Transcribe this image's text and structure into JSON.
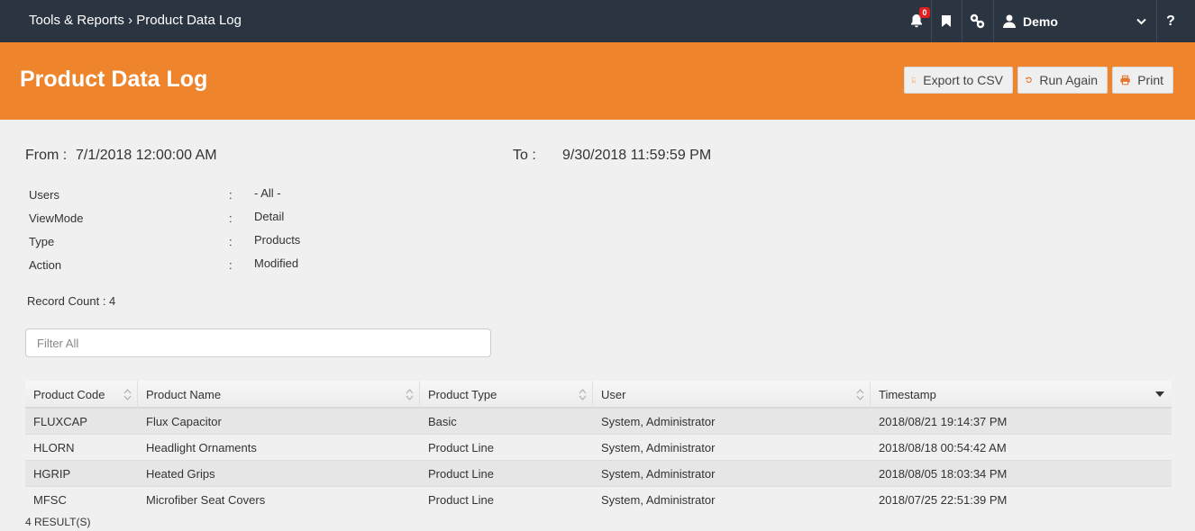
{
  "nav": {
    "breadcrumb_parent": "Tools & Reports",
    "breadcrumb_sep": "›",
    "breadcrumb_current": "Product Data Log",
    "notifications_count": "0",
    "user_name": "Demo",
    "help_label": "?"
  },
  "header": {
    "title": "Product Data Log",
    "export_label": "Export to CSV",
    "run_again_label": "Run Again",
    "print_label": "Print"
  },
  "params": {
    "from_label": "From :",
    "from_value": "7/1/2018 12:00:00 AM",
    "to_label": "To :",
    "to_value": "9/30/2018 11:59:59 PM",
    "rows": [
      {
        "key": "Users",
        "sep": ":",
        "value": "- All -"
      },
      {
        "key": "ViewMode",
        "sep": ":",
        "value": "Detail"
      },
      {
        "key": "Type",
        "sep": ":",
        "value": "Products"
      },
      {
        "key": "Action",
        "sep": ":",
        "value": "Modified"
      }
    ],
    "record_count": "Record Count : 4"
  },
  "filter": {
    "placeholder": "Filter All"
  },
  "table": {
    "columns": [
      "Product Code",
      "Product Name",
      "Product Type",
      "User",
      "Timestamp"
    ],
    "rows": [
      [
        "FLUXCAP",
        "Flux Capacitor",
        "Basic",
        "System, Administrator",
        "2018/08/21 19:14:37 PM"
      ],
      [
        "HLORN",
        "Headlight Ornaments",
        "Product Line",
        "System, Administrator",
        "2018/08/18 00:54:42 AM"
      ],
      [
        "HGRIP",
        "Heated Grips",
        "Product Line",
        "System, Administrator",
        "2018/08/05 18:03:34 PM"
      ],
      [
        "MFSC",
        "Microfiber Seat Covers",
        "Product Line",
        "System, Administrator",
        "2018/07/25 22:51:39 PM"
      ]
    ],
    "results_text": "4 RESULT(S)"
  },
  "colors": {
    "nav_bg": "#2b3441",
    "accent": "#ee852d",
    "badge": "#e02020"
  },
  "icons": [
    "bell-icon",
    "bookmark-icon",
    "link-icon",
    "user-icon",
    "chevron-down-icon",
    "help-icon",
    "csv-file-icon",
    "refresh-icon",
    "print-icon",
    "sort-icon",
    "sort-desc-icon"
  ]
}
